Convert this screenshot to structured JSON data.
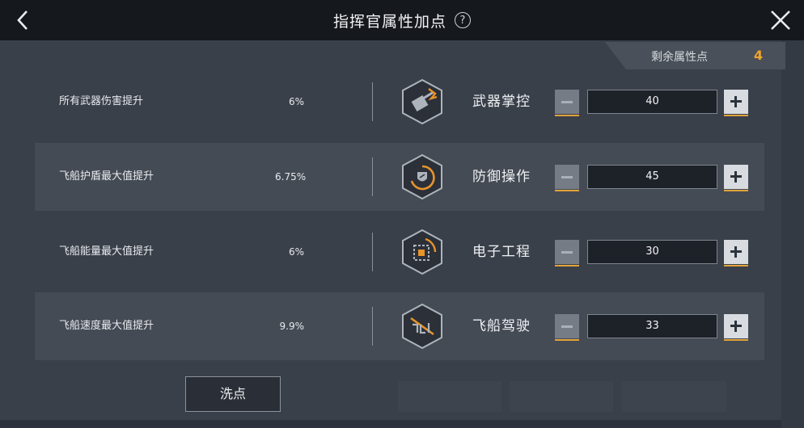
{
  "header": {
    "title": "指挥官属性加点",
    "help_glyph": "?",
    "back_icon": "chevron-left-icon",
    "close_icon": "close-icon"
  },
  "remaining": {
    "label": "剩余属性点",
    "value": "4"
  },
  "rows": [
    {
      "bonus_label": "所有武器伤害提升",
      "bonus_value": "6%",
      "icon": "weapon-turret-icon",
      "skill": "武器掌控",
      "points": "40"
    },
    {
      "bonus_label": "飞船护盾最大值提升",
      "bonus_value": "6.75%",
      "icon": "shield-icon",
      "skill": "防御操作",
      "points": "45"
    },
    {
      "bonus_label": "飞船能量最大值提升",
      "bonus_value": "6%",
      "icon": "energy-core-icon",
      "skill": "电子工程",
      "points": "30"
    },
    {
      "bonus_label": "飞船速度最大值提升",
      "bonus_value": "9.9%",
      "icon": "speed-icon",
      "skill": "飞船驾驶",
      "points": "33"
    }
  ],
  "footer": {
    "reset_label": "洗点"
  },
  "colors": {
    "accent": "#f0a52a",
    "header_bg": "#15181d",
    "panel_bg": "#3a404a",
    "row_shade": "#454b55"
  }
}
